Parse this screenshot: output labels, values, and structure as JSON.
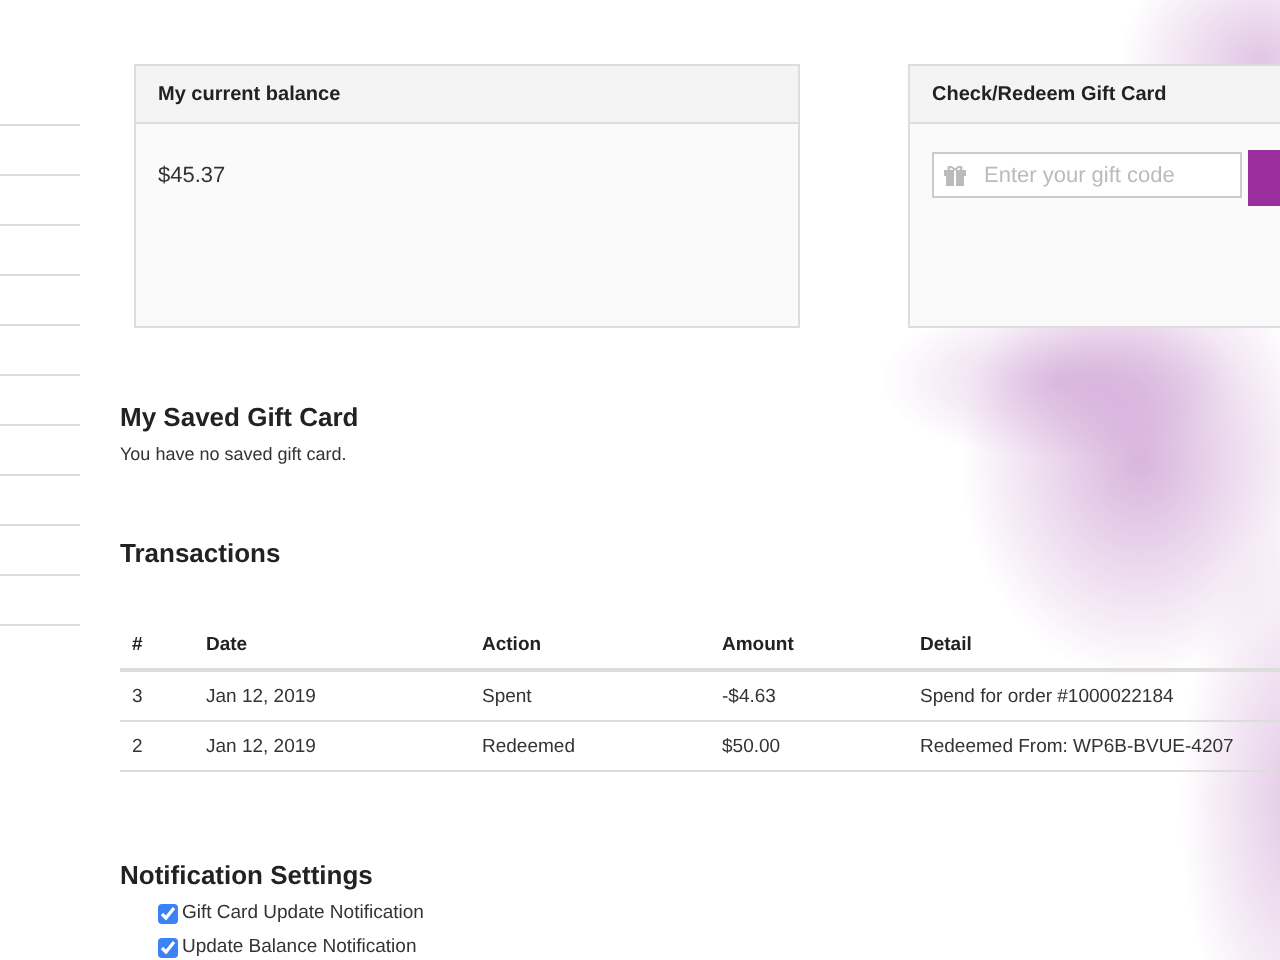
{
  "balance_card": {
    "title": "My current balance",
    "amount": "$45.37"
  },
  "gift_card": {
    "title": "Check/Redeem Gift Card",
    "placeholder": "Enter your gift code"
  },
  "saved_gift_card": {
    "heading": "My Saved Gift Card",
    "message": "You have no saved gift card."
  },
  "transactions": {
    "heading": "Transactions",
    "columns": [
      "#",
      "Date",
      "Action",
      "Amount",
      "Detail"
    ],
    "rows": [
      {
        "cells": [
          "3",
          "Jan 12, 2019",
          "Spent",
          "-$4.63",
          "Spend for order #1000022184"
        ]
      },
      {
        "cells": [
          "2",
          "Jan 12, 2019",
          "Redeemed",
          "$50.00",
          "Redeemed From: WP6B-BVUE-4207"
        ]
      }
    ]
  },
  "notification_settings": {
    "heading": "Notification Settings",
    "options": [
      {
        "label": "Gift Card Update Notification",
        "checked": true
      },
      {
        "label": "Update Balance Notification",
        "checked": true
      }
    ]
  }
}
